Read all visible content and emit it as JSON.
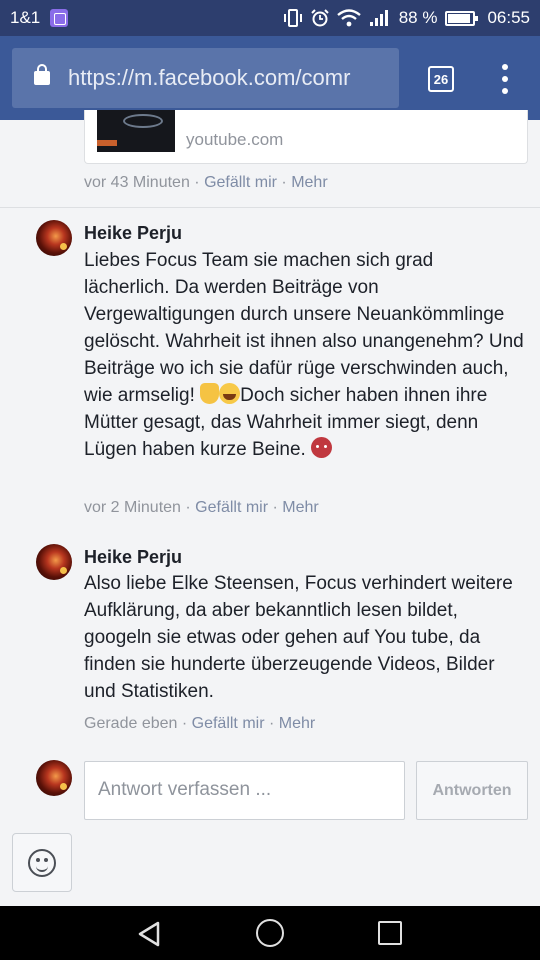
{
  "status_bar": {
    "carrier": "1&1",
    "battery_percent": "88 %",
    "time": "06:55",
    "icons": [
      "image-notification-icon",
      "vibrate-icon",
      "alarm-icon",
      "wifi-icon",
      "signal-icon",
      "battery-icon"
    ]
  },
  "browser": {
    "url": "https://m.facebook.com/comr",
    "tab_count": "26",
    "icons": [
      "lock-icon",
      "tabs-icon",
      "overflow-menu-icon"
    ]
  },
  "link_preview": {
    "domain": "youtube.com"
  },
  "post_meta": {
    "time": "vor 43 Minuten",
    "sep1": " · ",
    "like": "Gefällt mir",
    "sep2": " · ",
    "more": "Mehr"
  },
  "comments": [
    {
      "author": "Heike Perju",
      "text_part1": "Liebes Focus Team sie machen sich grad lächerlich. Da werden Beiträge von Vergewaltigungen durch unsere Neuankömmlinge gelöscht. Wahrheit ist ihnen also unangenehm? Und Beiträge wo ich sie dafür rüge verschwinden auch, wie armselig! ",
      "text_part2": "Doch sicher haben ihnen ihre Mütter gesagt, das Wahrheit immer siegt, denn Lügen haben kurze Beine. ",
      "emojis": [
        "thumbs-down-emoji",
        "laughing-tears-emoji",
        "devil-emoji"
      ],
      "time": "vor 2 Minuten",
      "sep1": " · ",
      "like": "Gefällt mir",
      "sep2": " · ",
      "more": "Mehr"
    },
    {
      "author": "Heike Perju",
      "text": "Also liebe Elke Steensen, Focus verhindert weitere Aufklärung, da aber bekanntlich lesen bildet, googeln sie etwas oder gehen auf You tube, da finden sie hunderte überzeugende Videos, Bilder und Statistiken.",
      "time": "Gerade eben",
      "sep1": " · ",
      "like": "Gefällt mir",
      "sep2": " · ",
      "more": "Mehr"
    }
  ],
  "reply": {
    "placeholder": "Antwort verfassen ...",
    "button": "Antworten"
  },
  "colors": {
    "status_bar": "#2d3e6e",
    "url_bar": "#3b5998",
    "url_field": "#5a74aa",
    "meta_text": "#90949c",
    "background": "#f3f4f6"
  }
}
